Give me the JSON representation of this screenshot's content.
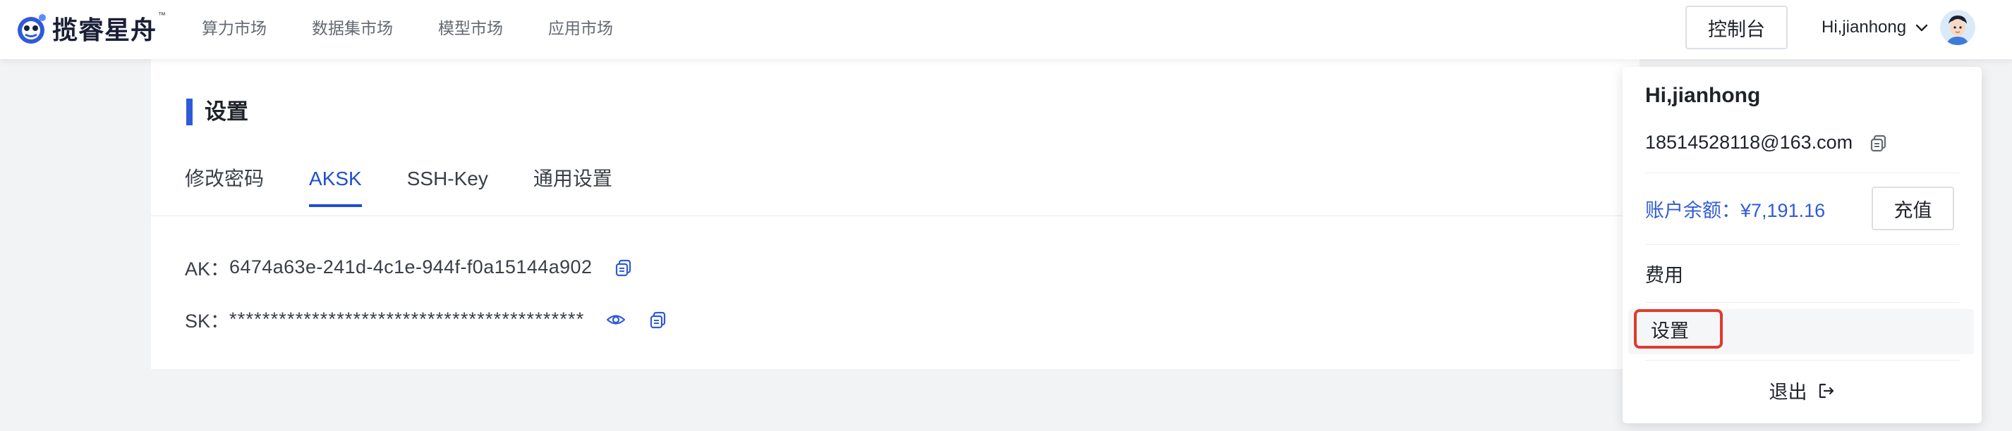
{
  "brand": {
    "name": "揽睿星舟",
    "tm": "™"
  },
  "nav": {
    "items": [
      "算力市场",
      "数据集市场",
      "模型市场",
      "应用市场"
    ]
  },
  "header": {
    "console_label": "控制台",
    "greeting": "Hi,jianhong"
  },
  "settings": {
    "title": "设置",
    "tabs": [
      "修改密码",
      "AKSK",
      "SSH-Key",
      "通用设置"
    ],
    "active_tab": "AKSK",
    "ak_label": "AK：",
    "ak_value": "6474a63e-241d-4c1e-944f-f0a15144a902",
    "sk_label": "SK：",
    "sk_value": "*******************************************"
  },
  "dropdown": {
    "name": "Hi,jianhong",
    "email": "18514528118@163.com",
    "balance_text": "账户余额：¥7,191.16",
    "recharge_label": "充值",
    "fee_label": "费用",
    "settings_label": "设置",
    "logout_label": "退出"
  },
  "colors": {
    "accent": "#2f5bd8",
    "active_tab": "#1e4fd0",
    "highlight_border": "#e03a2f",
    "page_bg": "#f2f3f5"
  },
  "icons": {
    "copy": "copy-icon",
    "eye": "eye-icon",
    "logout": "logout-icon",
    "chevron": "chevron-down-icon",
    "avatar": "avatar"
  }
}
